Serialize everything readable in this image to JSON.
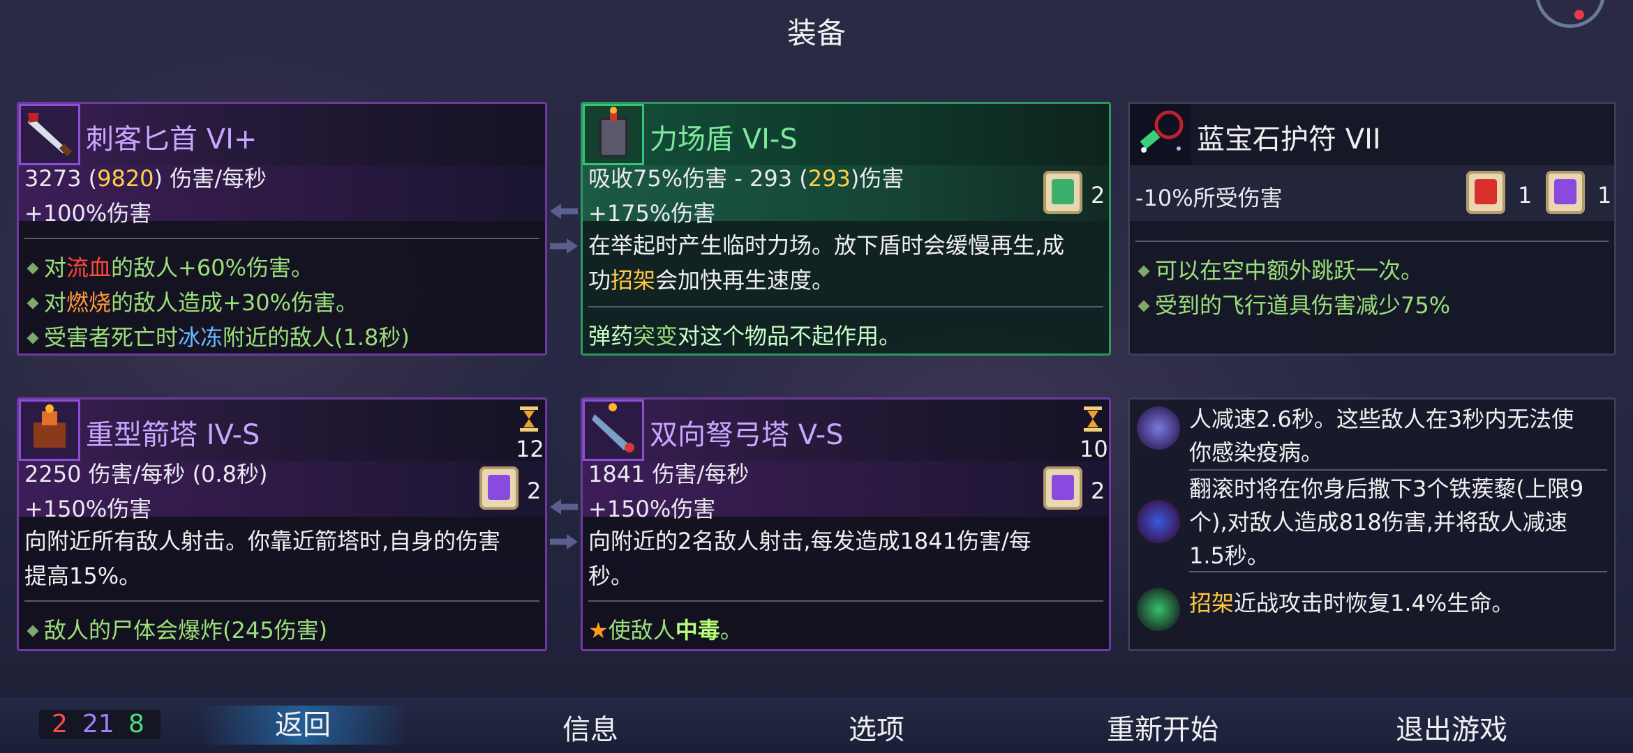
{
  "title": "装备",
  "items": {
    "dagger": {
      "name": "刺客匕首 VI+",
      "stat1_a": "3273 (",
      "stat1_b": "9820",
      "stat1_c": ") 伤害/每秒",
      "stat2": "+100%伤害",
      "b1_a": "对",
      "b1_b": "流血",
      "b1_c": "的敌人+60%伤害。",
      "b2_a": "对",
      "b2_b": "燃烧",
      "b2_c": "的敌人造成+30%伤害。",
      "b3_a": "受害者死亡时",
      "b3_b": "冰冻",
      "b3_c": "附近的敌人(1.8秒)"
    },
    "shield": {
      "name": "力场盾 VI-S",
      "stat1_a": "吸收75%伤害 - 293 (",
      "stat1_b": "293",
      "stat1_c": ")伤害",
      "stat2": "+175%伤害",
      "scroll_count": "2",
      "desc1": "在举起时产生临时力场。放下盾时会缓慢再生,成",
      "desc2_a": "功",
      "desc2_b": "招架",
      "desc2_c": "会加快再生速度。",
      "note_a": "弹药",
      "note_b": "突变",
      "note_c": "对这个物品不起作用。"
    },
    "amulet": {
      "name": "蓝宝石护符 VII",
      "stat1": "-10%所受伤害",
      "scroll1_count": "1",
      "scroll2_count": "1",
      "b1": "可以在空中额外跳跃一次。",
      "b2": "受到的飞行道具伤害减少75%"
    },
    "turret": {
      "name": "重型箭塔 IV-S",
      "cooldown": "12",
      "stat1": "2250 伤害/每秒 (0.8秒)",
      "stat2": "+150%伤害",
      "scroll_count": "2",
      "desc1": "向附近所有敌人射击。你靠近箭塔时,自身的伤害",
      "desc2": "提高15%。",
      "b1": "敌人的尸体会爆炸(245伤害)"
    },
    "crossbow": {
      "name": "双向弩弓塔 V-S",
      "cooldown": "10",
      "stat1": "1841 伤害/每秒",
      "stat2": "+150%伤害",
      "scroll_count": "2",
      "desc1": "向附近的2名敌人射击,每发造成1841伤害/每",
      "desc2": "秒。",
      "b1_a": "使敌人",
      "b1_b": "中毒",
      "b1_c": "。"
    }
  },
  "mutations": {
    "m1_l1": "人减速2.6秒。这些敌人在3秒内无法使",
    "m1_l2": "你感染疫病。",
    "m2_l1": "翻滚时将在你身后撒下3个铁蒺藜(上限9",
    "m2_l2": "个),对敌人造成818伤害,并将敌人减速",
    "m2_l3": "1.5秒。",
    "m3_a": "招架",
    "m3_b": "近战攻击时恢复1.4%生命。"
  },
  "counters": {
    "red": "2",
    "purple": "21",
    "green": "8"
  },
  "nav": {
    "back": "返回",
    "info": "信息",
    "options": "选项",
    "restart": "重新开始",
    "quit": "退出游戏"
  },
  "colors": {
    "accent_purple": "#6f3aa0",
    "accent_green": "#2c9a5c",
    "highlight_yellow": "#ffd24a"
  }
}
